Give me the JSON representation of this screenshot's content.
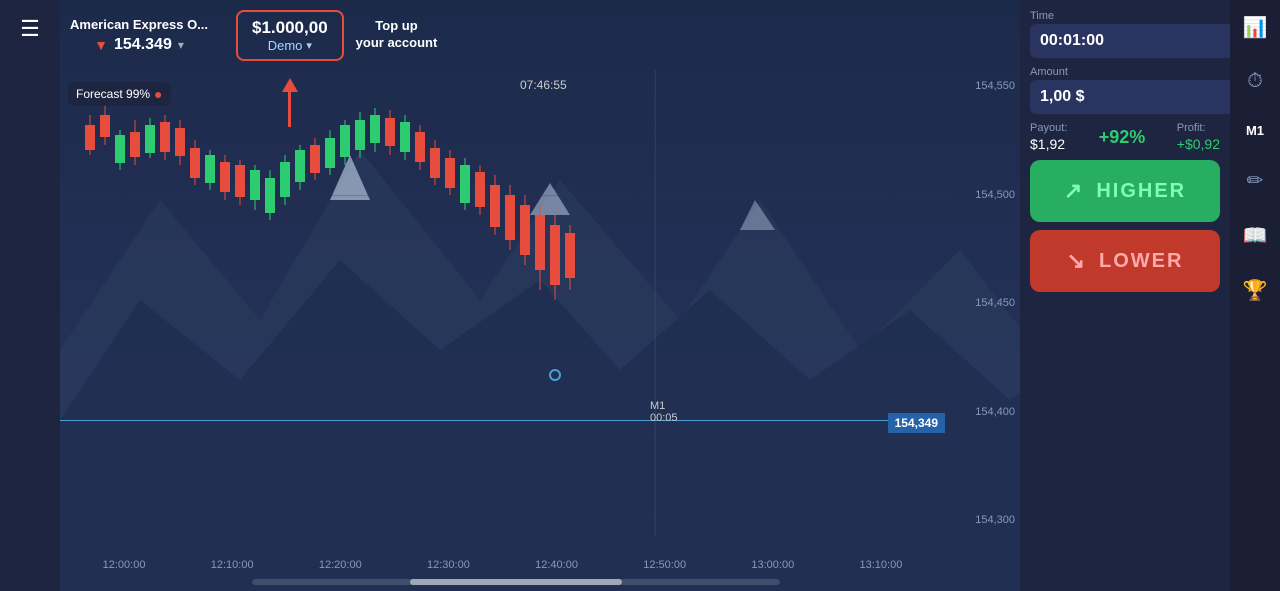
{
  "sidebar": {
    "hamburger": "☰"
  },
  "topbar": {
    "asset_name": "American Express O...",
    "asset_price": "154.349",
    "balance_amount": "$1.000,00",
    "balance_demo": "Demo",
    "topup_label": "Top up\nyour account",
    "chart_time": "07:46:55"
  },
  "forecast": {
    "label": "Forecast 99%"
  },
  "price_axis": {
    "p1": "154,550",
    "p2": "154,500",
    "p3": "154,450",
    "p4": "154,400",
    "p5": "154,349",
    "p6": "154,300"
  },
  "time_axis": {
    "t1": "12:00:00",
    "t2": "12:10:00",
    "t3": "12:20:00",
    "t4": "12:30:00",
    "t5": "12:40:00",
    "t6": "12:50:00",
    "t7": "13:00:00",
    "t8": "13:10:00"
  },
  "m1_label": "M1\n00:05",
  "right_panel": {
    "time_label": "Time",
    "time_value": "00:01:00",
    "amount_label": "Amount",
    "amount_value": "1,00 $",
    "payout_label": "Payout:",
    "payout_value": "$1,92",
    "payout_pct": "+92%",
    "profit_label": "Profit:",
    "profit_value": "+$0,92",
    "higher_label": "HIGHER",
    "lower_label": "LOWER"
  }
}
